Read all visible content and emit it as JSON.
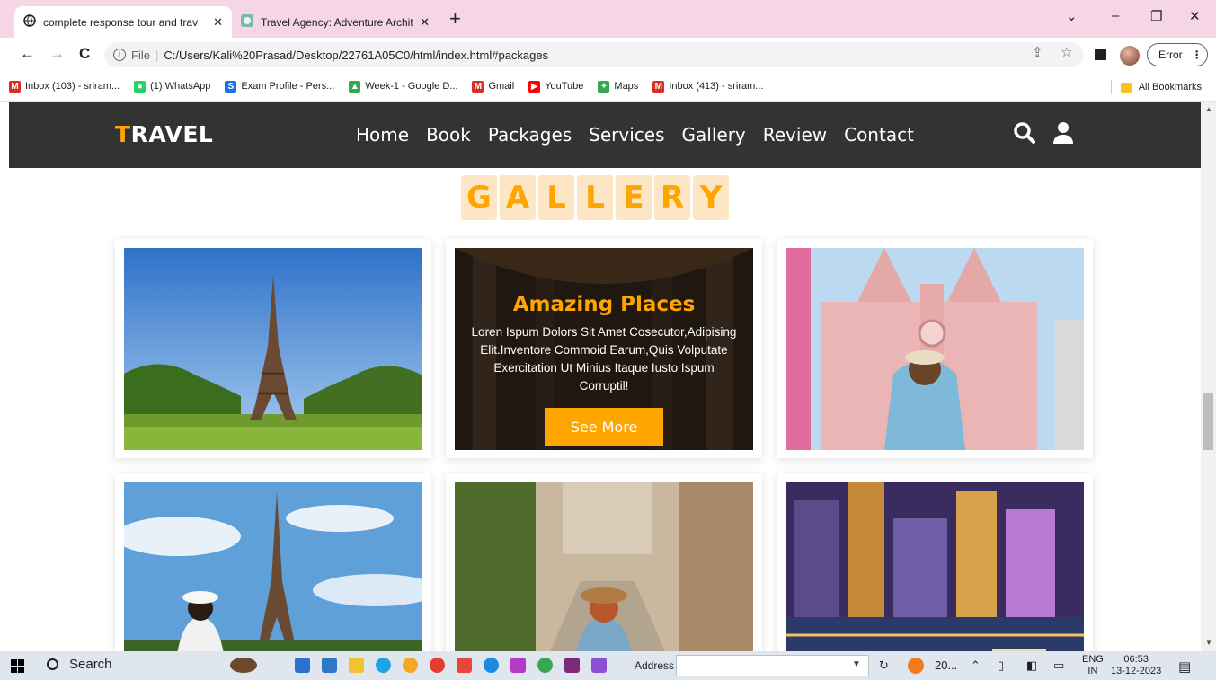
{
  "browser": {
    "tabs": [
      {
        "title": "complete response tour and trav",
        "active": true
      },
      {
        "title": "Travel Agency: Adventure Archit",
        "active": false
      }
    ],
    "new_tab": "+",
    "window_controls": {
      "list": "⌄",
      "minimize": "–",
      "restore": "❐",
      "close": "✕"
    },
    "url": {
      "scheme": "File",
      "path": "C:/Users/Kali%20Prasad/Desktop/22761A05C0/html/index.html#packages"
    },
    "error_label": "Error",
    "bookmarks": [
      {
        "label": "Inbox (103) - sriram...",
        "icon": "gmail-icon",
        "color": "#d93025",
        "glyph": "M"
      },
      {
        "label": "(1) WhatsApp",
        "icon": "whatsapp-icon",
        "color": "#25d366",
        "glyph": "●"
      },
      {
        "label": "Exam Profile - Pers...",
        "icon": "s-icon",
        "color": "#1a73e8",
        "glyph": "S"
      },
      {
        "label": "Week-1 - Google D...",
        "icon": "drive-icon",
        "color": "#34a853",
        "glyph": "▲"
      },
      {
        "label": "Gmail",
        "icon": "gmail-icon",
        "color": "#d93025",
        "glyph": "M"
      },
      {
        "label": "YouTube",
        "icon": "youtube-icon",
        "color": "#ff0000",
        "glyph": "▶"
      },
      {
        "label": "Maps",
        "icon": "maps-icon",
        "color": "#34a853",
        "glyph": "✦"
      },
      {
        "label": "Inbox (413) - sriram...",
        "icon": "gmail-icon",
        "color": "#d93025",
        "glyph": "M"
      }
    ],
    "all_bookmarks": "All Bookmarks"
  },
  "site": {
    "logo_first": "T",
    "logo_rest": "RAVEL",
    "nav": [
      "Home",
      "Book",
      "Packages",
      "Services",
      "Gallery",
      "Review",
      "Contact"
    ],
    "colors": {
      "accent": "#ffa500",
      "header": "#333333"
    },
    "gallery_letters": [
      "G",
      "A",
      "L",
      "L",
      "E",
      "R",
      "Y"
    ],
    "overlay": {
      "title": "Amazing Places",
      "text": "Loren Ispum Dolors Sit Amet Cosecutor,Adipising Elit.Inventore Commoid Earum,Quis Volputate Exercitation Ut Minius Itaque Iusto Ispum Corruptil!",
      "button": "See More"
    }
  },
  "taskbar": {
    "search": "Search",
    "address_label": "Address",
    "weather": "20...",
    "lang_top": "ENG",
    "lang_bottom": "IN",
    "time": "06:53",
    "date": "13-12-2023"
  }
}
